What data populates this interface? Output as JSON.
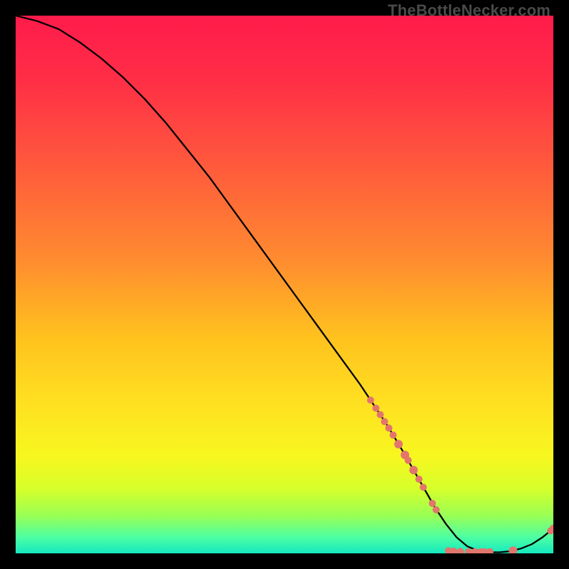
{
  "watermark": "TheBottleNecker.com",
  "colors": {
    "line": "#000000",
    "marker_fill": "#e2766c",
    "marker_stroke": "#d85f56",
    "gradient_stops": [
      {
        "offset": 0.0,
        "color": "#ff1b4b"
      },
      {
        "offset": 0.12,
        "color": "#ff2e46"
      },
      {
        "offset": 0.28,
        "color": "#ff5a3c"
      },
      {
        "offset": 0.45,
        "color": "#ff8a30"
      },
      {
        "offset": 0.6,
        "color": "#ffc21e"
      },
      {
        "offset": 0.72,
        "color": "#ffe021"
      },
      {
        "offset": 0.82,
        "color": "#f7f71f"
      },
      {
        "offset": 0.88,
        "color": "#d6ff2a"
      },
      {
        "offset": 0.93,
        "color": "#99ff55"
      },
      {
        "offset": 0.97,
        "color": "#4dffa3"
      },
      {
        "offset": 1.0,
        "color": "#15e8c0"
      }
    ]
  },
  "chart_data": {
    "type": "line",
    "title": "",
    "xlabel": "",
    "ylabel": "",
    "xlim": [
      0,
      100
    ],
    "ylim": [
      0,
      100
    ],
    "series": [
      {
        "name": "curve",
        "x": [
          0,
          4,
          8,
          12,
          16,
          20,
          24,
          28,
          32,
          36,
          40,
          44,
          48,
          52,
          56,
          60,
          64,
          66,
          69,
          70.5,
          72,
          74,
          76,
          78,
          80,
          82,
          84,
          86,
          88,
          90,
          92,
          94,
          96,
          98,
          99,
          100
        ],
        "y": [
          100,
          99,
          97.5,
          95,
          92,
          88.5,
          84.5,
          80,
          75,
          70,
          64.5,
          59,
          53.5,
          48,
          42.5,
          37,
          31.5,
          28.5,
          24,
          21.5,
          19,
          15.5,
          12,
          8.5,
          5.5,
          3,
          1.3,
          0.5,
          0.2,
          0.2,
          0.4,
          0.9,
          1.7,
          3,
          3.8,
          4.6
        ]
      }
    ],
    "markers": {
      "name": "cluster",
      "points": [
        {
          "x": 66.0,
          "y": 28.5,
          "r": 5
        },
        {
          "x": 67.0,
          "y": 27.0,
          "r": 5
        },
        {
          "x": 67.8,
          "y": 25.8,
          "r": 5
        },
        {
          "x": 68.6,
          "y": 24.5,
          "r": 5
        },
        {
          "x": 69.4,
          "y": 23.3,
          "r": 5
        },
        {
          "x": 70.2,
          "y": 22.0,
          "r": 5
        },
        {
          "x": 71.2,
          "y": 20.3,
          "r": 6
        },
        {
          "x": 72.4,
          "y": 18.3,
          "r": 6
        },
        {
          "x": 73.0,
          "y": 17.3,
          "r": 5
        },
        {
          "x": 74.0,
          "y": 15.5,
          "r": 6
        },
        {
          "x": 75.0,
          "y": 13.8,
          "r": 5
        },
        {
          "x": 75.8,
          "y": 12.3,
          "r": 5
        },
        {
          "x": 77.5,
          "y": 9.3,
          "r": 5
        },
        {
          "x": 78.2,
          "y": 8.1,
          "r": 5
        },
        {
          "x": 80.5,
          "y": 0.5,
          "r": 5
        },
        {
          "x": 81.5,
          "y": 0.4,
          "r": 5
        },
        {
          "x": 82.7,
          "y": 0.35,
          "r": 5
        },
        {
          "x": 84.2,
          "y": 0.3,
          "r": 5
        },
        {
          "x": 85.4,
          "y": 0.3,
          "r": 5
        },
        {
          "x": 86.5,
          "y": 0.3,
          "r": 5
        },
        {
          "x": 87.2,
          "y": 0.3,
          "r": 5
        },
        {
          "x": 88.2,
          "y": 0.3,
          "r": 5
        },
        {
          "x": 92.5,
          "y": 0.5,
          "r": 6
        },
        {
          "x": 99.5,
          "y": 4.2,
          "r": 5
        },
        {
          "x": 100,
          "y": 4.7,
          "r": 5
        }
      ]
    }
  }
}
